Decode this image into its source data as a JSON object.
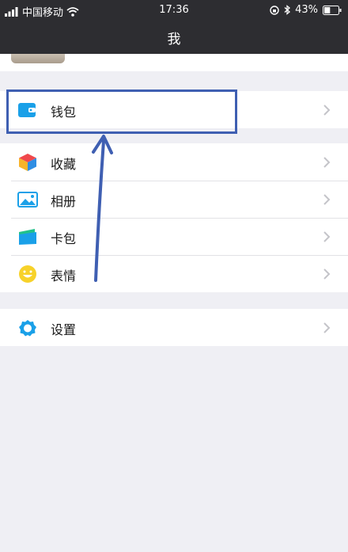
{
  "status_bar": {
    "carrier": "中国移动",
    "time": "17:36",
    "battery_percent": "43%",
    "battery_level": 0.43
  },
  "nav": {
    "title": "我"
  },
  "menu": {
    "wallet": {
      "label": "钱包",
      "icon": "wallet-icon"
    },
    "items": [
      {
        "label": "收藏",
        "icon": "favorites-cube-icon"
      },
      {
        "label": "相册",
        "icon": "album-icon"
      },
      {
        "label": "卡包",
        "icon": "card-wallet-icon"
      },
      {
        "label": "表情",
        "icon": "smiley-icon"
      }
    ],
    "settings": {
      "label": "设置",
      "icon": "gear-icon"
    }
  },
  "annotation": {
    "highlight_color": "#3f5fb2"
  },
  "colors": {
    "bar_background": "#2d2d31",
    "page_background": "#efeff4",
    "accent_blue": "#1aa0e8"
  }
}
